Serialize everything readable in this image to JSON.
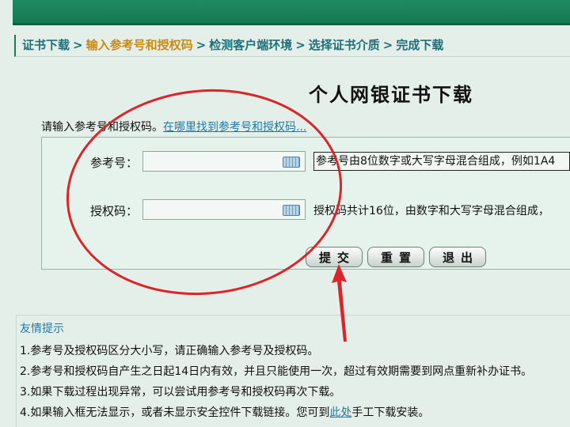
{
  "breadcrumb": {
    "step1": "证书下载",
    "step2": "输入参考号和授权码",
    "step3": "检测客户端环境",
    "step4": "选择证书介质",
    "step5": "完成下载",
    "separator": ">"
  },
  "page": {
    "title": "个人网银证书下载"
  },
  "form": {
    "prompt": "请输入参考号和授权码。",
    "help_link": "在哪里找到参考号和授权码...",
    "ref_label": "参考号：",
    "ref_value": "",
    "ref_hint": "参考号由8位数字或大写字母混合组成，例如1A4",
    "auth_label": "授权码：",
    "auth_value": "",
    "auth_hint": "授权码共计16位，由数字和大写字母混合组成，"
  },
  "buttons": {
    "submit": "提交",
    "reset": "重置",
    "exit": "退出"
  },
  "tips": {
    "title": "友情提示",
    "item1": "1.参考号及授权码区分大小写，请正确输入参考号及授权码。",
    "item2": "2.参考号和授权码自产生之日起14日内有效，并且只能使用一次，超过有效期需要到网点重新补办证书。",
    "item3": "3.如果下载过程出现异常，可以尝试用参考号和授权码再次下载。",
    "item4_before": "4.如果输入框无法显示，或者未显示安全控件下载链接。您可到",
    "item4_link": "此处",
    "item4_after": "手工下载安装。"
  },
  "colors": {
    "annotation": "#d8262b",
    "brand_green": "#147a52",
    "link": "#1f79a6",
    "current_step": "#c98a10"
  },
  "icons": {
    "keyboard": "keyboard-icon"
  }
}
